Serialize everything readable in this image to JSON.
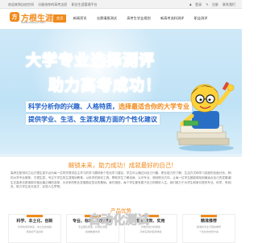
{
  "topbar": {
    "links": [
      "欢迎来到自由空间",
      "分配给你的高考志愿",
      "职业生涯管理平台"
    ],
    "login": "登录",
    "register": "注册",
    "contact": "联系我们"
  },
  "logo": {
    "mark": "方",
    "name": "方根生涯",
    "url": "www.eduzyu.com"
  },
  "nav": [
    {
      "label": "首页",
      "active": true
    },
    {
      "label": "新闻资讯",
      "active": false
    },
    {
      "label": "志愿填报测试",
      "active": false
    },
    {
      "label": "高考生学业规划",
      "active": false
    },
    {
      "label": "新高考选科测评",
      "active": false
    },
    {
      "label": "职业测评",
      "active": false
    }
  ],
  "banner": {
    "title1": "大学专业选择测评",
    "title2": "助力高考成功！",
    "line3_a": "科学分析你的兴趣、人格特质，",
    "line3_b": "选择最适合你的大学专业",
    "line4": "提供学业、生活、生涯发展方面的个性化建议"
  },
  "slogan": "解锁未来，助力成功！成就最好的自己!",
  "paragraph": [
    "高考志愿测评之后方根生涯平台为每一位同学提供自主学习的学习模块和个性化学习建议，学生可以通过对自己兴趣、职业能力的了解，生活方式和学习态度的全面分析，获得最适合自己",
    "的大学专业推荐。方根生涯，专注于学生的生涯规划教育，以科学的测评工具，帮助学生了解自我、认识专业、规划职业方向，让每一位学生都能够找到最适合自己的发展道路，让学",
    "生在高考志愿填报中做出最正确的选择，为未来的职业发展奠定坚实的基础。我们相信，每个学生都有属于自己的精彩人生。我们致力于为学生和家长提供专业、科学、有效的生涯服",
    "务，助力学生成长成才，实现人生梦想。"
  ],
  "products": {
    "title": "产品优势",
    "cards": [
      {
        "heading": "科学、本土化、创新",
        "line1": "科学的测评体系，本土化的常模",
        "line2": "持续的产品创新"
      },
      {
        "heading": "专业、标准、权威建设",
        "line1": "专业团队研发，标准化流程",
        "line2": "权威数据支持"
      },
      {
        "heading": "智能高效、实用",
        "line1": "智能化的分析报告",
        "line2": "高效实用的使用体验"
      },
      {
        "heading": "精准推荐",
        "line1": "精准的专业与院校推荐",
        "line2": "个性化的志愿方案"
      }
    ]
  },
  "watermark": "自动化测试",
  "colors": {
    "accent": "#f08a1c",
    "blue": "#1d5fc9",
    "banner_bg": "#cfe9f8"
  }
}
